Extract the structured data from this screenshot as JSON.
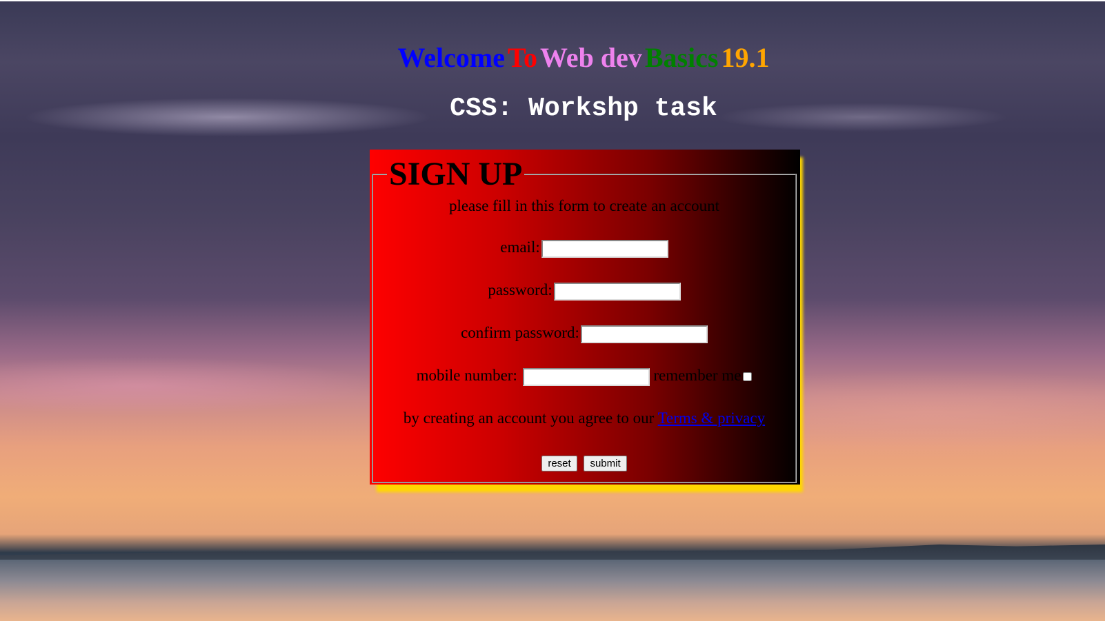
{
  "header": {
    "title_words": [
      {
        "text": "Welcome",
        "color": "#0000ff"
      },
      {
        "text": "To",
        "color": "#ff0000"
      },
      {
        "text": "Web dev",
        "color": "#ee82ee"
      },
      {
        "text": "Basics",
        "color": "#008000"
      },
      {
        "text": "19.1",
        "color": "#ffa500"
      }
    ],
    "subtitle": "CSS: Workshp task"
  },
  "form": {
    "legend": "SIGN UP",
    "intro": "please fill in this form to create an account",
    "email_label": "email:",
    "email_value": "",
    "password_label": "password:",
    "password_value": "",
    "confirm_label": "confirm password:",
    "confirm_value": "",
    "mobile_label": "mobile number:",
    "mobile_value": "",
    "remember_label": "remember me",
    "remember_checked": false,
    "terms_text": "by creating an account you agree to our",
    "terms_link": "Terms & privacy",
    "reset_label": "reset",
    "submit_label": "submit"
  },
  "colors": {
    "panel_gradient_start": "#ff0000",
    "panel_gradient_end": "#000000",
    "shadow": "#ffd700",
    "subtitle": "#ffffff"
  }
}
